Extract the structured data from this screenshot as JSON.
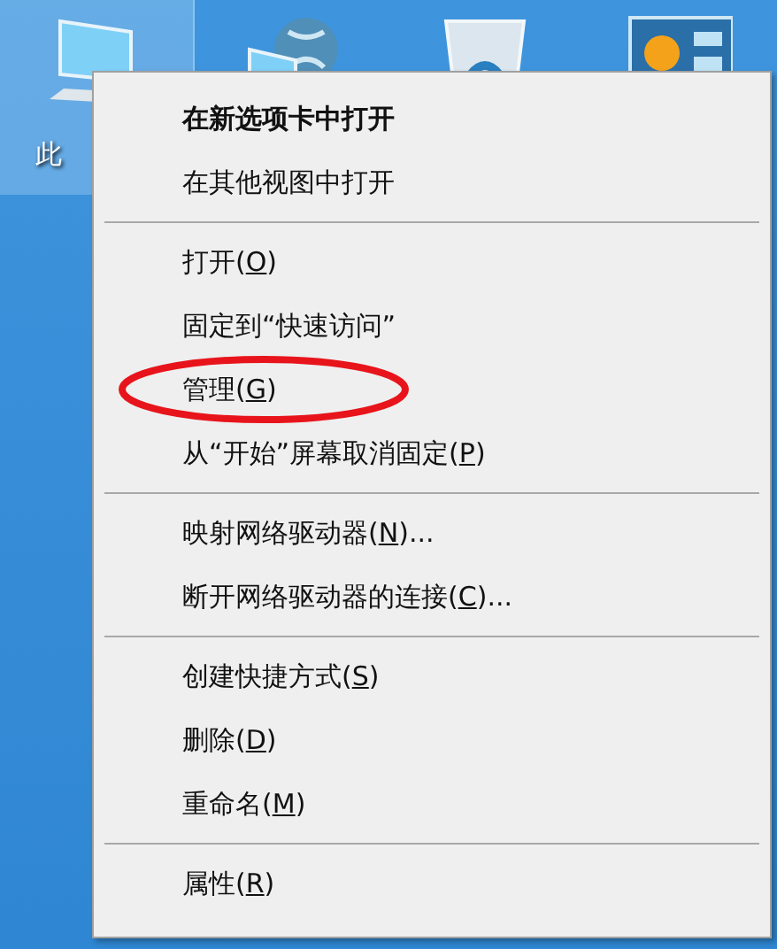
{
  "desktop_icons": [
    {
      "kind": "computer",
      "label": "此",
      "selected": true
    },
    {
      "kind": "network",
      "selected": false
    },
    {
      "kind": "recycle-bin",
      "selected": false
    },
    {
      "kind": "control-panel",
      "selected": false
    }
  ],
  "context_menu": {
    "sections": [
      {
        "items": [
          {
            "text_before": "在新选项卡中打开",
            "bold": true,
            "circled": false
          },
          {
            "text_before": "在其他视图中打开",
            "bold": false,
            "circled": false
          }
        ]
      },
      {
        "items": [
          {
            "text_before": "打开(",
            "key": "O",
            "text_after": ")",
            "bold": false,
            "circled": false
          },
          {
            "text_before": "固定到“快速访问”",
            "bold": false,
            "circled": false
          },
          {
            "text_before": "管理(",
            "key": "G",
            "text_after": ")",
            "bold": false,
            "circled": true
          },
          {
            "text_before": "从“开始”屏幕取消固定(",
            "key": "P",
            "text_after": ")",
            "bold": false,
            "circled": false
          }
        ]
      },
      {
        "items": [
          {
            "text_before": "映射网络驱动器(",
            "key": "N",
            "text_after": ")...",
            "bold": false,
            "circled": false
          },
          {
            "text_before": "断开网络驱动器的连接(",
            "key": "C",
            "text_after": ")...",
            "bold": false,
            "circled": false
          }
        ]
      },
      {
        "items": [
          {
            "text_before": "创建快捷方式(",
            "key": "S",
            "text_after": ")",
            "bold": false,
            "circled": false
          },
          {
            "text_before": "删除(",
            "key": "D",
            "text_after": ")",
            "bold": false,
            "circled": false
          },
          {
            "text_before": "重命名(",
            "key": "M",
            "text_after": ")",
            "bold": false,
            "circled": false
          }
        ]
      },
      {
        "items": [
          {
            "text_before": "属性(",
            "key": "R",
            "text_after": ")",
            "bold": false,
            "circled": false
          }
        ]
      }
    ]
  }
}
